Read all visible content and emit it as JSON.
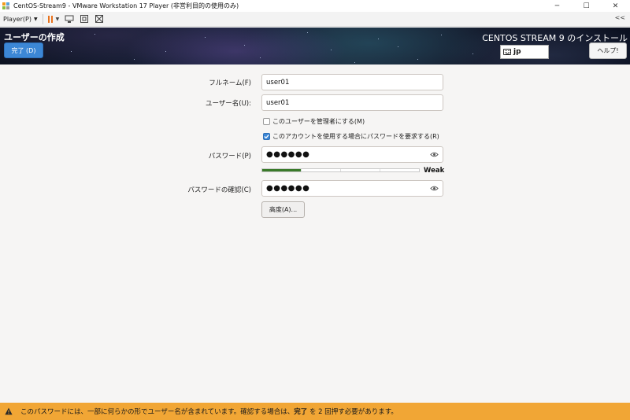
{
  "window": {
    "title": "CentOS-Stream9 - VMware Workstation 17 Player (非営利目的の使用のみ)",
    "controls": [
      "─",
      "☐",
      "✕"
    ]
  },
  "toolbar": {
    "player_label": "Player(P)",
    "collapse_label": "<<"
  },
  "header": {
    "page_title": "ユーザーの作成",
    "done_label": "完了 (D)",
    "product_title": "CENTOS STREAM 9 のインストール",
    "keyboard_layout": "jp",
    "help_label": "ヘルプ!"
  },
  "form": {
    "fullname_label": "フルネーム(F)",
    "fullname_value": "user01",
    "username_label": "ユーザー名(U):",
    "username_value": "user01",
    "admin_checkbox_label": "このユーザーを管理者にする(M)",
    "admin_checked": false,
    "require_password_label": "このアカウントを使用する場合にパスワードを要求する(R)",
    "require_password_checked": true,
    "password_label": "パスワード(P)",
    "password_value": "●●●●●●",
    "strength_label": "Weak",
    "strength_level": 0.25,
    "confirm_label": "パスワードの確認(C)",
    "confirm_value": "●●●●●●",
    "advanced_label": "高度(A)..."
  },
  "warning": {
    "text_before": "このパスワードには、一部に何らかの形でユーザー名が含まれています。確認する場合は、",
    "text_bold": "完了",
    "text_after": " を 2 回押す必要があります。",
    "color": "#f1a635"
  },
  "icons": [
    "vmware-icon",
    "pause-icon",
    "send-ctrl-alt-del-icon",
    "fullscreen-icon",
    "unity-icon",
    "keyboard-icon",
    "eye-icon",
    "warning-icon",
    "check-icon"
  ]
}
